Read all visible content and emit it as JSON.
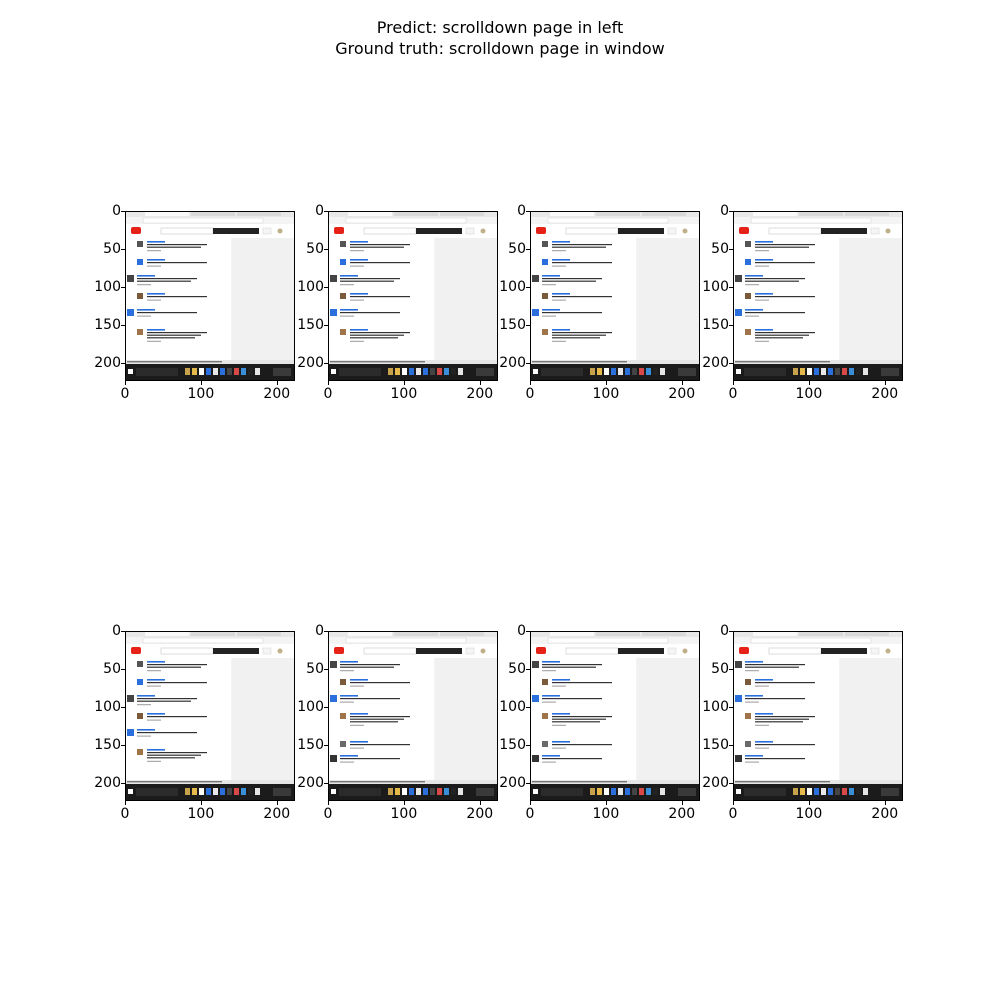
{
  "figure": {
    "title_line1": "Predict: scrolldown page in left",
    "title_line2": "Ground truth: scrolldown page in window"
  },
  "axes": {
    "x_ticks": [
      "0",
      "100",
      "200"
    ],
    "y_ticks": [
      "0",
      "50",
      "100",
      "150",
      "200"
    ]
  },
  "colors": {
    "browser_chrome": "#e8e8e8",
    "youtube_red": "#e62117",
    "link_blue": "#2a6fdb",
    "sidebar_gray": "#f1f1f1",
    "taskbar_dark": "#1b1b1b"
  },
  "frames": [
    {
      "variant": "a"
    },
    {
      "variant": "a"
    },
    {
      "variant": "a"
    },
    {
      "variant": "a"
    },
    {
      "variant": "a"
    },
    {
      "variant": "b"
    },
    {
      "variant": "b"
    },
    {
      "variant": "b"
    }
  ]
}
